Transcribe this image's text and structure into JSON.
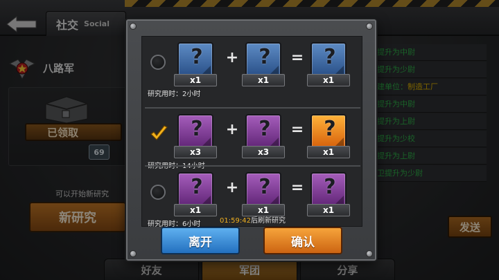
{
  "header": {
    "title_cn": "社交",
    "title_en": "Social",
    "back_icon": "back-arrow-icon"
  },
  "legion": {
    "name": "八路军"
  },
  "reward": {
    "claimed_label": "已领取",
    "level_badge": "69"
  },
  "research_panel": {
    "tip": "可以开始新研究",
    "new_research_label": "新研究"
  },
  "feed": [
    {
      "text": "提升为中尉",
      "highlight": ""
    },
    {
      "text": "提升为少尉",
      "highlight": ""
    },
    {
      "text": "建单位：",
      "highlight": "制造工厂"
    },
    {
      "text": "提升为中尉",
      "highlight": ""
    },
    {
      "text": "提升为上尉",
      "highlight": ""
    },
    {
      "text": "提升为少校",
      "highlight": ""
    },
    {
      "text": "提升为上尉",
      "highlight": ""
    },
    {
      "text": "卫提升为少尉",
      "highlight": ""
    }
  ],
  "send_label": "发送",
  "bottom_tabs": [
    {
      "label": "好友",
      "active": false
    },
    {
      "label": "军团",
      "active": true
    },
    {
      "label": "分享",
      "active": false
    }
  ],
  "modal": {
    "recipes": [
      {
        "selected": false,
        "inputs": [
          {
            "color": "blue",
            "count": "x1"
          },
          {
            "color": "blue",
            "count": "x1"
          }
        ],
        "output": {
          "color": "blue",
          "count": "x1"
        },
        "time_label": "研究用时：2小时"
      },
      {
        "selected": true,
        "inputs": [
          {
            "color": "purple",
            "count": "x3"
          },
          {
            "color": "purple",
            "count": "x3"
          }
        ],
        "output": {
          "color": "orange",
          "count": "x1"
        },
        "time_label": "研究用时：14小时"
      },
      {
        "selected": false,
        "inputs": [
          {
            "color": "purple",
            "count": "x1"
          },
          {
            "color": "purple",
            "count": "x1"
          }
        ],
        "output": {
          "color": "purple",
          "count": "x1"
        },
        "time_label": "研究用时：6小时"
      }
    ],
    "plus": "+",
    "equals": "=",
    "item_glyph": "?",
    "refresh_timer": "01:59:42",
    "refresh_suffix": "后刷新研究",
    "leave_label": "离开",
    "confirm_label": "确认",
    "colors": {
      "blue": "#3f6fa9",
      "purple": "#8a3fa3",
      "orange": "#f08a1e",
      "check": "#f2b21c"
    }
  }
}
